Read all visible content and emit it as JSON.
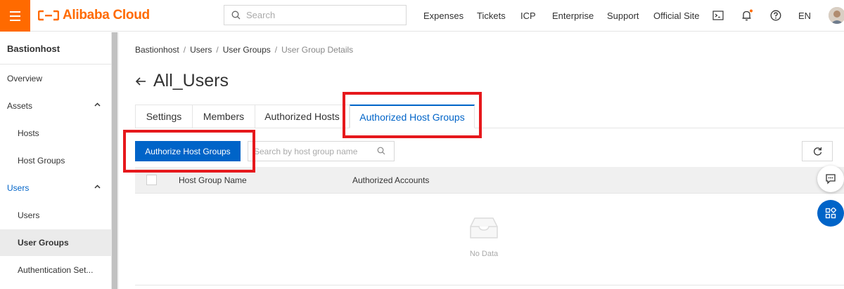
{
  "topbar": {
    "logo_text": "Alibaba Cloud",
    "search_placeholder": "Search",
    "nav": [
      "Expenses",
      "Tickets",
      "ICP",
      "Enterprise",
      "Support",
      "Official Site"
    ],
    "lang": "EN",
    "brand_color": "#ff6a00"
  },
  "sidebar": {
    "title": "Bastionhost",
    "items": [
      {
        "label": "Overview"
      },
      {
        "label": "Assets"
      },
      {
        "label": "Hosts"
      },
      {
        "label": "Host Groups"
      },
      {
        "label": "Users"
      },
      {
        "label": "Users"
      },
      {
        "label": "User Groups"
      },
      {
        "label": "Authentication Set..."
      }
    ]
  },
  "breadcrumb": [
    "Bastionhost",
    "Users",
    "User Groups",
    "User Group Details"
  ],
  "page": {
    "title": "All_Users"
  },
  "tabs": [
    "Settings",
    "Members",
    "Authorized Hosts",
    "Authorized Host Groups"
  ],
  "active_tab": "Authorized Host Groups",
  "toolbar": {
    "authorize_button": "Authorize Host Groups",
    "search_placeholder": "Search by host group name"
  },
  "table": {
    "columns": [
      "Host Group Name",
      "Authorized Accounts"
    ],
    "empty_text": "No Data"
  },
  "colors": {
    "accent": "#0064c8",
    "highlight": "#e6181c"
  }
}
